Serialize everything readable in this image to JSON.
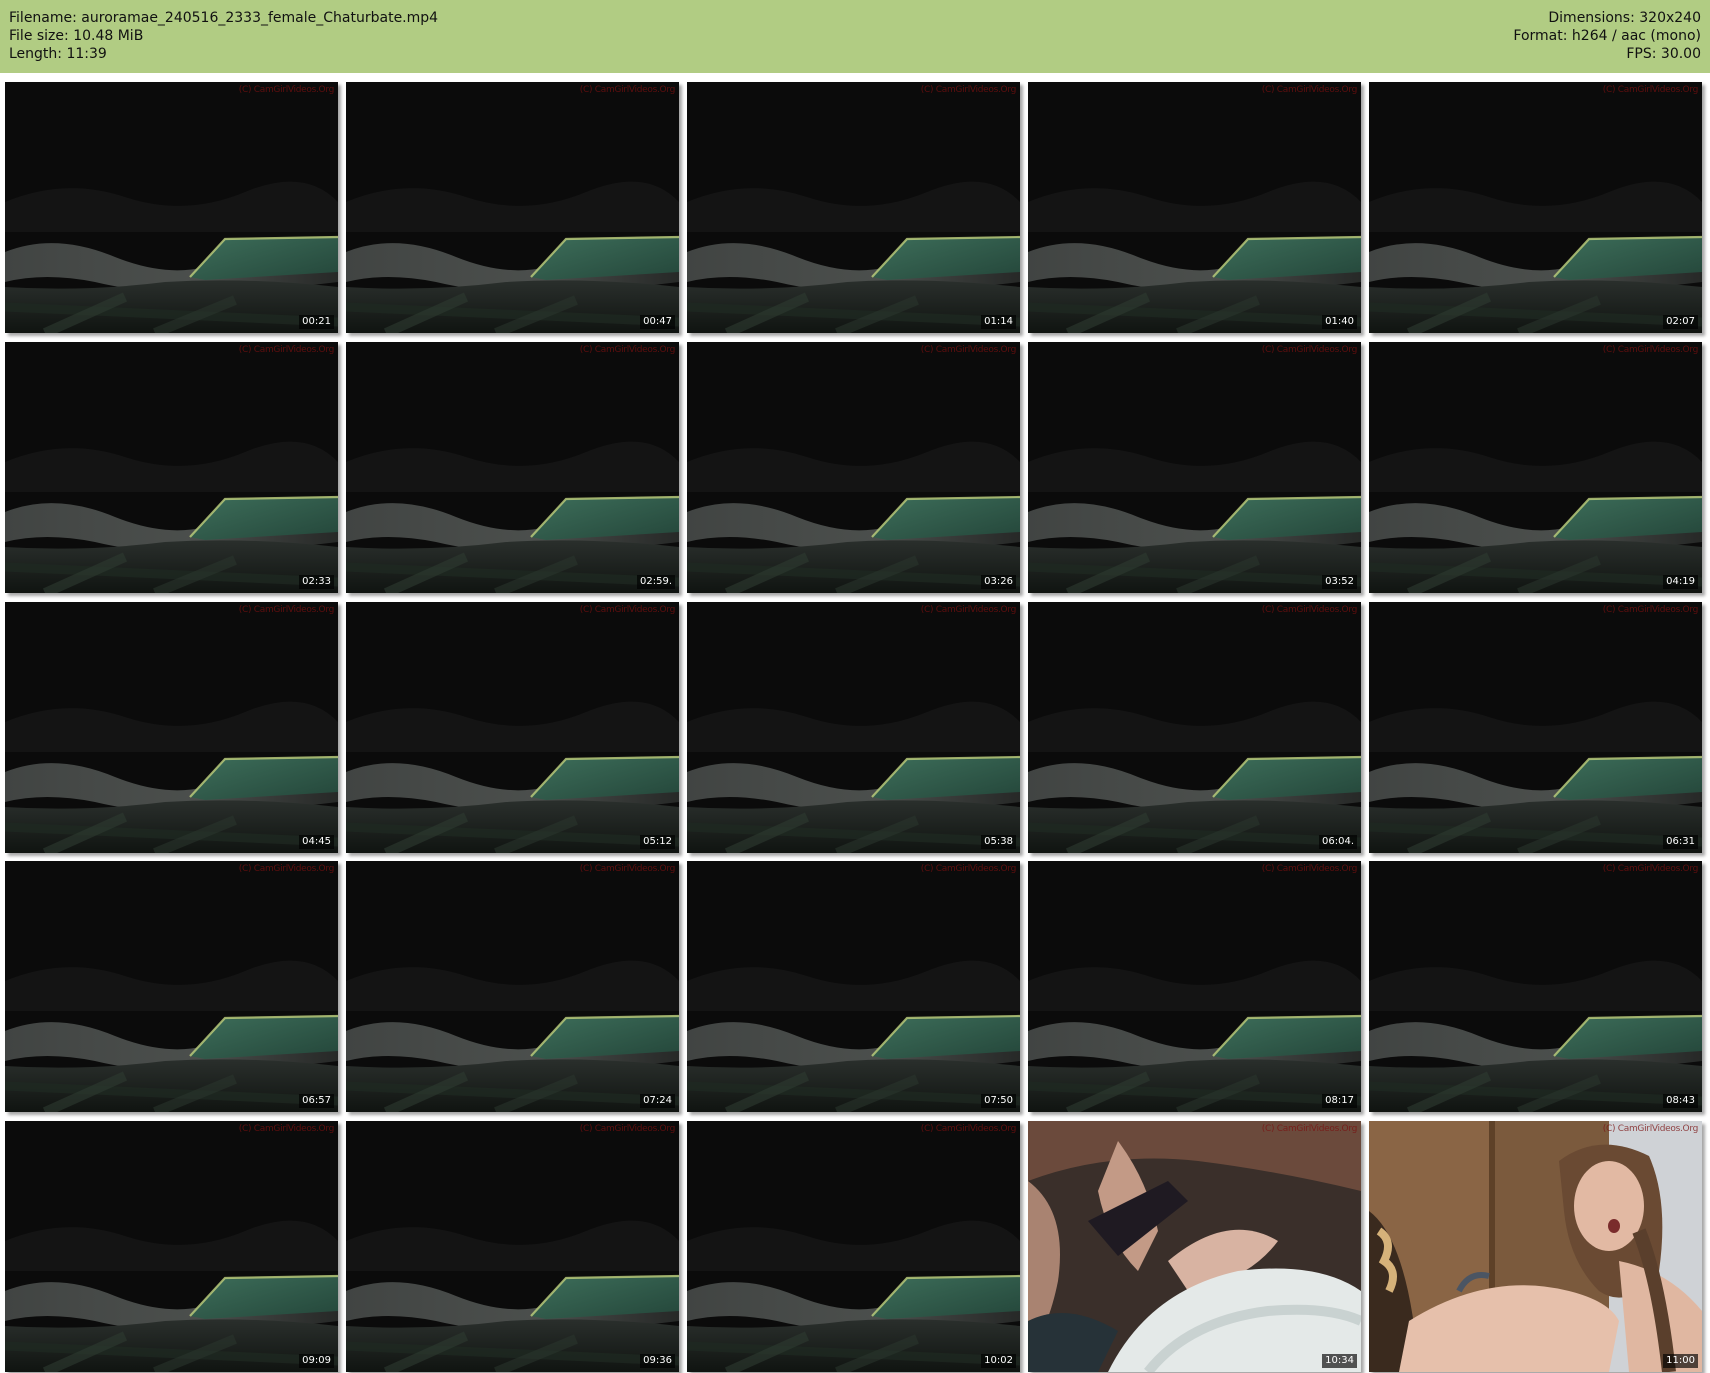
{
  "header": {
    "filename": "Filename: auroramae_240516_2333_female_Chaturbate.mp4",
    "file_size": "File size: 10.48 MiB",
    "length": "Length: 11:39",
    "dimensions": "Dimensions: 320x240",
    "format": "Format: h264 / aac (mono)",
    "fps": "FPS: 30.00"
  },
  "watermark": "(C) CamGirlVideos.Org",
  "colors": {
    "header_bg": "#b1cc83",
    "dark_frame_bg": "#0b0b0b",
    "stripe_color": "#8fcf9a"
  },
  "frames": [
    {
      "time": "00:21",
      "scene": "dark"
    },
    {
      "time": "00:47",
      "scene": "dark"
    },
    {
      "time": "01:14",
      "scene": "dark"
    },
    {
      "time": "01:40",
      "scene": "dark"
    },
    {
      "time": "02:07",
      "scene": "dark"
    },
    {
      "time": "02:33",
      "scene": "dark"
    },
    {
      "time": "02:59.",
      "scene": "dark"
    },
    {
      "time": "03:26",
      "scene": "dark"
    },
    {
      "time": "03:52",
      "scene": "dark"
    },
    {
      "time": "04:19",
      "scene": "dark"
    },
    {
      "time": "04:45",
      "scene": "dark"
    },
    {
      "time": "05:12",
      "scene": "dark"
    },
    {
      "time": "05:38",
      "scene": "dark"
    },
    {
      "time": "06:04.",
      "scene": "dark"
    },
    {
      "time": "06:31",
      "scene": "dark"
    },
    {
      "time": "06:57",
      "scene": "dark"
    },
    {
      "time": "07:24",
      "scene": "dark"
    },
    {
      "time": "07:50",
      "scene": "dark"
    },
    {
      "time": "08:17",
      "scene": "dark"
    },
    {
      "time": "08:43",
      "scene": "dark"
    },
    {
      "time": "09:09",
      "scene": "dark"
    },
    {
      "time": "09:36",
      "scene": "dark"
    },
    {
      "time": "10:02",
      "scene": "dark"
    },
    {
      "time": "10:34",
      "scene": "closeup"
    },
    {
      "time": "11:00",
      "scene": "person"
    }
  ]
}
